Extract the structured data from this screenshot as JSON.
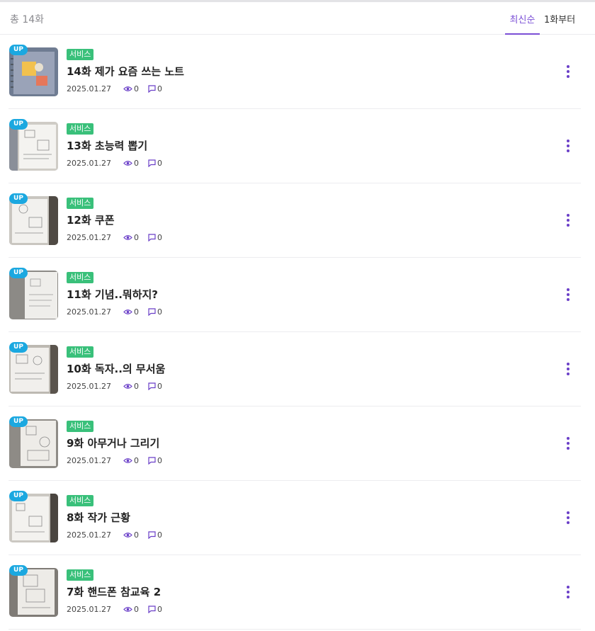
{
  "header": {
    "total": "총 14화",
    "sort_newest": "최신순",
    "sort_first": "1화부터"
  },
  "colors": {
    "accent": "#7b4fd6",
    "up_badge": "#1ba8e0",
    "tag": "#39c07a"
  },
  "episodes": [
    {
      "badge": "UP",
      "tag": "서비스",
      "title": "14화 제가 요즘 쓰는 노트",
      "date": "2025.01.27",
      "views": "0",
      "comments": "0"
    },
    {
      "badge": "UP",
      "tag": "서비스",
      "title": "13화 초능력 뽑기",
      "date": "2025.01.27",
      "views": "0",
      "comments": "0"
    },
    {
      "badge": "UP",
      "tag": "서비스",
      "title": "12화 쿠폰",
      "date": "2025.01.27",
      "views": "0",
      "comments": "0"
    },
    {
      "badge": "UP",
      "tag": "서비스",
      "title": "11화 기념..뭐하지?",
      "date": "2025.01.27",
      "views": "0",
      "comments": "0"
    },
    {
      "badge": "UP",
      "tag": "서비스",
      "title": "10화 독자..의 무서움",
      "date": "2025.01.27",
      "views": "0",
      "comments": "0"
    },
    {
      "badge": "UP",
      "tag": "서비스",
      "title": "9화 아무거나 그리기",
      "date": "2025.01.27",
      "views": "0",
      "comments": "0"
    },
    {
      "badge": "UP",
      "tag": "서비스",
      "title": "8화 작가 근황",
      "date": "2025.01.27",
      "views": "0",
      "comments": "0"
    },
    {
      "badge": "UP",
      "tag": "서비스",
      "title": "7화 핸드폰 참교육 2",
      "date": "2025.01.27",
      "views": "0",
      "comments": "0"
    }
  ]
}
